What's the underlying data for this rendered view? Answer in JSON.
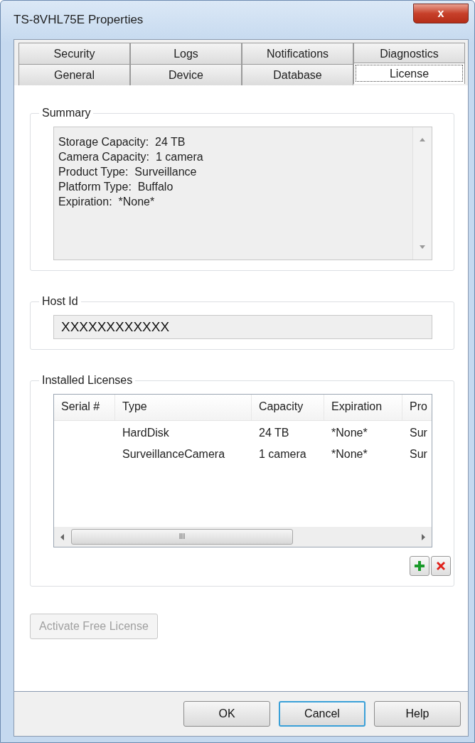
{
  "window": {
    "title": "TS-8VHL75E Properties",
    "close": "x"
  },
  "tab_rows": [
    [
      {
        "label": "Security",
        "selected": false
      },
      {
        "label": "Logs",
        "selected": false
      },
      {
        "label": "Notifications",
        "selected": false
      },
      {
        "label": "Diagnostics",
        "selected": false
      }
    ],
    [
      {
        "label": "General",
        "selected": false
      },
      {
        "label": "Device",
        "selected": false
      },
      {
        "label": "Database",
        "selected": false
      },
      {
        "label": "License",
        "selected": true
      }
    ]
  ],
  "summary": {
    "title": "Summary",
    "lines": [
      "Storage Capacity:  24 TB",
      "Camera Capacity:  1 camera",
      "Product Type:  Surveillance",
      "Platform Type:  Buffalo",
      "Expiration:  *None*"
    ]
  },
  "host_id": {
    "title": "Host Id",
    "value": "XXXXXXXXXXXX"
  },
  "installed_licenses": {
    "title": "Installed Licenses",
    "table": {
      "columns": [
        "Serial #",
        "Type",
        "Capacity",
        "Expiration",
        "Pro"
      ],
      "rows": [
        [
          "",
          "HardDisk",
          "24 TB",
          "*None*",
          "Sur"
        ],
        [
          "",
          "SurveillanceCamera",
          "1 camera",
          "*None*",
          "Sur"
        ]
      ]
    },
    "scroll_thumb": "III"
  },
  "activate_button": {
    "label": "Activate Free License",
    "disabled": true
  },
  "buttons": [
    {
      "label": "OK",
      "focused": false
    },
    {
      "label": "Cancel",
      "focused": true
    },
    {
      "label": "Help",
      "focused": false
    }
  ]
}
